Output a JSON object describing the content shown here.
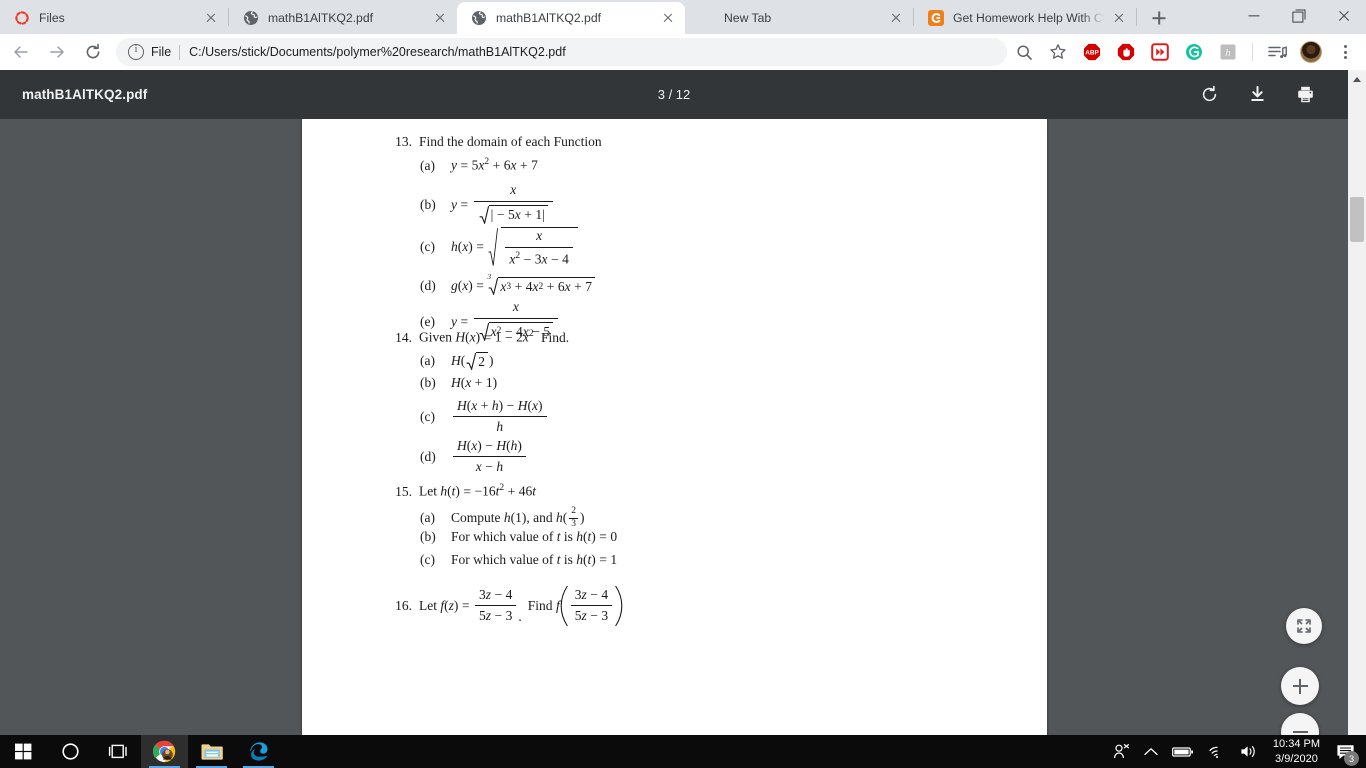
{
  "browser": {
    "tabs": [
      {
        "title": "Files",
        "favicon": "files-orbit-icon",
        "active": false
      },
      {
        "title": "mathB1AlTKQ2.pdf",
        "favicon": "globe-icon",
        "active": false
      },
      {
        "title": "mathB1AlTKQ2.pdf",
        "favicon": "globe-icon",
        "active": true
      },
      {
        "title": "New Tab",
        "favicon": "none",
        "active": false
      },
      {
        "title": "Get Homework Help With Che",
        "favicon": "chegg-icon",
        "active": false
      }
    ],
    "new_tab_label": "+",
    "window_controls": {
      "minimize": "minimize-icon",
      "maximize": "maximize-icon",
      "close": "close-icon"
    },
    "omnibox": {
      "security_label": "File",
      "url": "C:/Users/stick/Documents/polymer%20research/mathB1AlTKQ2.pdf",
      "info_icon": "info-circle-icon"
    },
    "toolbar_icons": [
      {
        "name": "zoom-out-page-icon",
        "label": ""
      },
      {
        "name": "bookmark-star-icon",
        "label": ""
      },
      {
        "name": "adblock-plus-extension",
        "label": "ABP",
        "color": "#d40000"
      },
      {
        "name": "ublock-origin-extension",
        "label": "",
        "color": "#d40000"
      },
      {
        "name": "video-downloader-extension",
        "label": "",
        "color": "#e02020"
      },
      {
        "name": "grammarly-extension",
        "label": "G",
        "color": "#15c39a"
      },
      {
        "name": "honey-extension",
        "label": "h",
        "color": "#bdbdbd"
      }
    ],
    "media_icon": "media-playlist-icon",
    "avatar": "profile-avatar",
    "menu": "three-dot-menu-icon"
  },
  "pdf": {
    "filename": "mathB1AlTKQ2.pdf",
    "page_indicator": "3 / 12",
    "current_page": 3,
    "total_pages": 12,
    "tools": [
      {
        "name": "rotate-icon"
      },
      {
        "name": "download-icon"
      },
      {
        "name": "print-icon"
      }
    ],
    "zoom_controls": [
      {
        "name": "fit-to-page-button"
      },
      {
        "name": "zoom-in-button"
      },
      {
        "name": "zoom-out-button"
      }
    ]
  },
  "document": {
    "problems": [
      {
        "number": "13.",
        "stem": "Find the domain of each Function",
        "items": [
          {
            "label": "(a)",
            "text": "y = 5x² + 6x + 7"
          },
          {
            "label": "(b)",
            "text": "y = x / √|−5x + 1|"
          },
          {
            "label": "(c)",
            "text": "h(x) = √( x / (x² − 3x − 4) )"
          },
          {
            "label": "(d)",
            "text": "g(x) = ∛(x³ + 4x² + 6x + 7)"
          },
          {
            "label": "(e)",
            "text": "y = x / √(x² − 4x − 5)"
          }
        ]
      },
      {
        "number": "14.",
        "stem": "Given H(x) = 1 − 2x² Find.",
        "items": [
          {
            "label": "(a)",
            "text": "H(√2)"
          },
          {
            "label": "(b)",
            "text": "H(x + 1)"
          },
          {
            "label": "(c)",
            "text": "(H(x + h) − H(x)) / h"
          },
          {
            "label": "(d)",
            "text": "(H(x) − H(h)) / (x − h)"
          }
        ]
      },
      {
        "number": "15.",
        "stem": "Let h(t) = −16t² + 46t",
        "items": [
          {
            "label": "(a)",
            "text": "Compute h(1), and h(2/3)"
          },
          {
            "label": "(b)",
            "text": "For which value of t is h(t) = 0"
          },
          {
            "label": "(c)",
            "text": "For which value of t is h(t) = 1"
          }
        ]
      },
      {
        "number": "16.",
        "stem": "Let f(z) = (3z − 4)/(5z − 3). Find f((3z − 4)/(5z − 3))",
        "items": []
      }
    ],
    "tokens": {
      "p13_num": "13.",
      "p13_stem": "Find the domain of each Function",
      "p13a_label": "(a)",
      "p13b_label": "(b)",
      "p13c_label": "(c)",
      "p13d_label": "(d)",
      "p13e_label": "(e)",
      "p14_num": "14.",
      "p14_given": "Given",
      "p14_find": "Find.",
      "p14a_label": "(a)",
      "p14b_label": "(b)",
      "p14c_label": "(c)",
      "p14d_label": "(d)",
      "p15_num": "15.",
      "p15_let": "Let",
      "p15a_label": "(a)",
      "p15b_label": "(b)",
      "p15c_label": "(c)",
      "p15a_compute": "Compute",
      "p15a_and": ", and",
      "p15b_for": "For which value of",
      "p15b_is": "is",
      "p16_num": "16.",
      "p16_let": "Let",
      "p16_find": "Find"
    }
  },
  "taskbar": {
    "start": "windows-start-icon",
    "cortana": "cortana-circle-icon",
    "taskview": "task-view-icon",
    "apps": [
      {
        "name": "chrome-taskbar-icon",
        "running": true,
        "focused": true
      },
      {
        "name": "file-explorer-taskbar-icon",
        "running": true,
        "focused": false
      },
      {
        "name": "edge-taskbar-icon",
        "running": true,
        "focused": false
      }
    ],
    "tray": [
      {
        "name": "people-icon"
      },
      {
        "name": "show-hidden-icons-chevron"
      },
      {
        "name": "battery-icon"
      },
      {
        "name": "wifi-icon"
      },
      {
        "name": "volume-icon"
      }
    ],
    "time": "10:34 PM",
    "date": "3/9/2020",
    "notifications_count": "3"
  }
}
